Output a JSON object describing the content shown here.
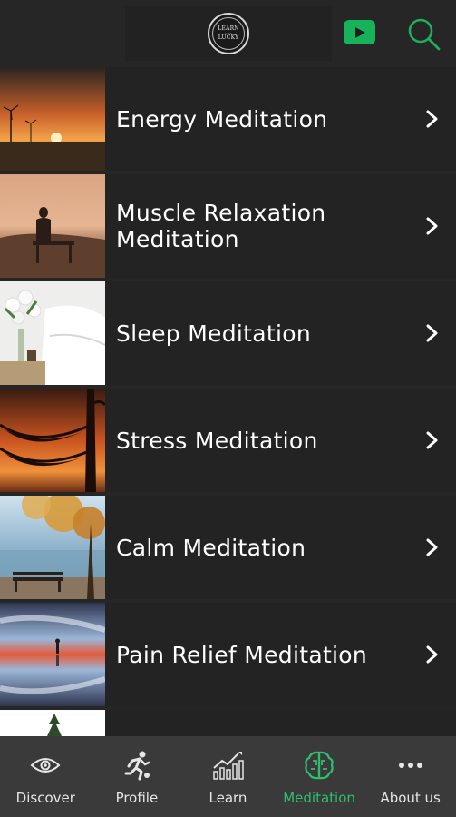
{
  "header": {
    "logo": {
      "top": "LEARN",
      "mid": "with",
      "bottom": "LUCKY"
    },
    "youtube_icon": "youtube-icon",
    "search_icon": "search-icon"
  },
  "meditations": [
    {
      "label": "Energy Meditation",
      "thumb": "sunset-wind-turbines"
    },
    {
      "label": "Muscle Relaxation Meditation",
      "thumb": "person-sitting-bench-sunset"
    },
    {
      "label": "Sleep Meditation",
      "thumb": "white-flowers-bedroom"
    },
    {
      "label": "Stress Meditation",
      "thumb": "hammocks-sunset"
    },
    {
      "label": "Calm Meditation",
      "thumb": "bench-by-lake-autumn"
    },
    {
      "label": "Pain Relief Meditation",
      "thumb": "person-reflection-sky"
    }
  ],
  "bottom_nav": [
    {
      "label": "Discover",
      "icon": "eye-icon",
      "active": false
    },
    {
      "label": "Profile",
      "icon": "runner-icon",
      "active": false
    },
    {
      "label": "Learn",
      "icon": "bar-chart-icon",
      "active": false
    },
    {
      "label": "Meditation",
      "icon": "brain-icon",
      "active": true
    },
    {
      "label": "About us",
      "icon": "more-dots-icon",
      "active": false
    }
  ],
  "colors": {
    "background": "#262626",
    "row_background": "#232323",
    "accent": "#2dbf6d",
    "youtube_green": "#16b35a",
    "nav_background": "#3a3a3a"
  }
}
